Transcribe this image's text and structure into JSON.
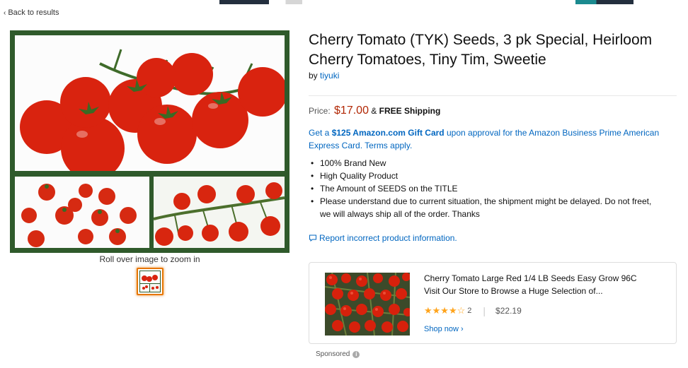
{
  "nav": {
    "back_label": "Back to results"
  },
  "gallery": {
    "zoom_hint": "Roll over image to zoom in"
  },
  "product": {
    "title": "Cherry Tomato (TYK) Seeds, 3 pk Special, Heirloom Cherry Tomatoes, Tiny Tim, Sweetie",
    "by_prefix": "by",
    "seller": "tiyuki",
    "price_label": "Price:",
    "price": "$17.00",
    "ampersand": "&",
    "shipping": "FREE Shipping",
    "promo_prefix": "Get a",
    "promo_highlight": "$125 Amazon.com Gift Card",
    "promo_rest": "upon approval for the Amazon Business Prime American Express Card. Terms apply.",
    "bullets": [
      "100% Brand New",
      "High Quality Product",
      "The Amount of SEEDS on the TITLE",
      "Please understand due to current situation, the shipment might be delayed. Do not freet, we will always ship all of the order. Thanks"
    ],
    "report_label": "Report incorrect product information."
  },
  "sponsored": {
    "title_line1": "Cherry Tomato Large Red 1/4 LB Seeds Easy Grow 96C",
    "title_line2": "Visit Our Store to Browse a Huge Selection of...",
    "rating": 4.5,
    "stars_text": "★★★★☆",
    "review_count": "2",
    "separator": "|",
    "price": "$22.19",
    "shop_now": "Shop now ›",
    "label": "Sponsored",
    "info_glyph": "i"
  },
  "colors": {
    "accent_link": "#0066c0",
    "price": "#b12704",
    "frame_green": "#2f5a2b",
    "star": "#ffa41c",
    "thumb_border": "#e77600"
  },
  "icons": {
    "back": "chevron-left-icon",
    "report": "comment-icon",
    "info": "info-icon"
  }
}
